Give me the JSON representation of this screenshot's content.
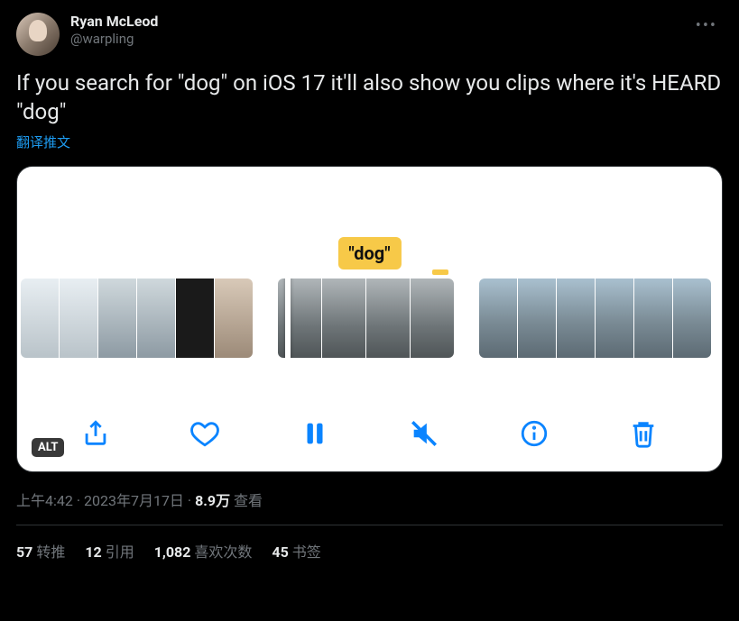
{
  "author": {
    "display_name": "Ryan McLeod",
    "handle": "@warpling"
  },
  "body": "If you search for \"dog\" on iOS 17 it'll also show you clips where it's HEARD \"dog\"",
  "translate_label": "翻译推文",
  "media": {
    "keyword_bubble": "\"dog\"",
    "alt_badge": "ALT"
  },
  "meta": {
    "time": "上午4:42",
    "date": "2023年7月17日",
    "views_count": "8.9万",
    "views_label": "查看"
  },
  "stats": {
    "retweets_count": "57",
    "retweets_label": "转推",
    "quotes_count": "12",
    "quotes_label": "引用",
    "likes_count": "1,082",
    "likes_label": "喜欢次数",
    "bookmarks_count": "45",
    "bookmarks_label": "书签"
  }
}
